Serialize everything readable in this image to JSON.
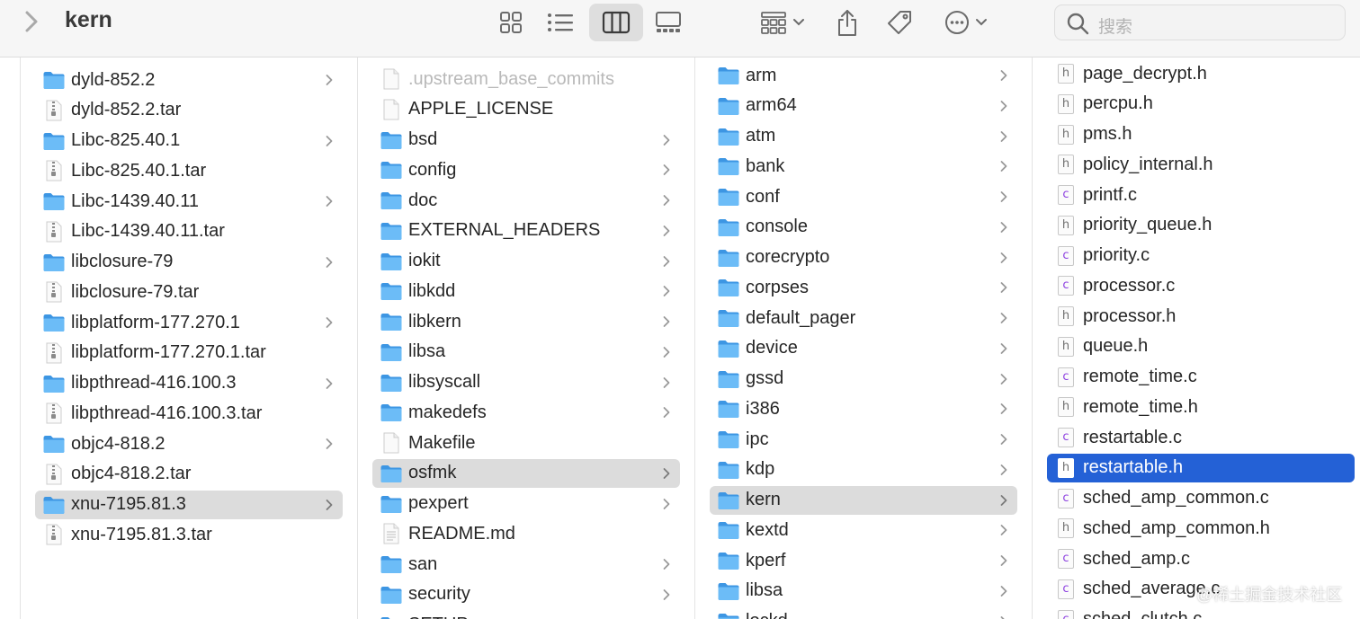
{
  "window": {
    "title": "kern"
  },
  "toolbar": {
    "back_icon": "chevron-left-icon",
    "view_buttons": [
      "icon-view-icon",
      "list-view-icon",
      "column-view-icon",
      "gallery-view-icon"
    ],
    "active_view": "column-view",
    "group_icon": "group-grid-icon",
    "share_icon": "share-icon",
    "tag_icon": "tag-icon",
    "more_icon": "ellipsis-circle-icon",
    "search": {
      "placeholder": "搜索"
    }
  },
  "colors": {
    "selected_row": "#dcdcdc",
    "active_row": "#2461d6",
    "folder": "#5aaef2",
    "c_file_letter": "#8c3fe0"
  },
  "columns": [
    {
      "items": [
        {
          "label": "dyld-852.2",
          "type": "folder",
          "chevron": true
        },
        {
          "label": "dyld-852.2.tar",
          "type": "archive",
          "chevron": false
        },
        {
          "label": "Libc-825.40.1",
          "type": "folder",
          "chevron": true
        },
        {
          "label": "Libc-825.40.1.tar",
          "type": "archive",
          "chevron": false
        },
        {
          "label": "Libc-1439.40.11",
          "type": "folder",
          "chevron": true
        },
        {
          "label": "Libc-1439.40.11.tar",
          "type": "archive",
          "chevron": false
        },
        {
          "label": "libclosure-79",
          "type": "folder",
          "chevron": true
        },
        {
          "label": "libclosure-79.tar",
          "type": "archive",
          "chevron": false
        },
        {
          "label": "libplatform-177.270.1",
          "type": "folder",
          "chevron": true
        },
        {
          "label": "libplatform-177.270.1.tar",
          "type": "archive",
          "chevron": false
        },
        {
          "label": "libpthread-416.100.3",
          "type": "folder",
          "chevron": true
        },
        {
          "label": "libpthread-416.100.3.tar",
          "type": "archive",
          "chevron": false
        },
        {
          "label": "objc4-818.2",
          "type": "folder",
          "chevron": true
        },
        {
          "label": "objc4-818.2.tar",
          "type": "archive",
          "chevron": false
        },
        {
          "label": "xnu-7195.81.3",
          "type": "folder",
          "chevron": true,
          "selected": true
        },
        {
          "label": "xnu-7195.81.3.tar",
          "type": "archive",
          "chevron": false
        }
      ]
    },
    {
      "items": [
        {
          "label": ".upstream_base_commits",
          "type": "file",
          "chevron": false,
          "dim": true
        },
        {
          "label": "APPLE_LICENSE",
          "type": "file",
          "chevron": false
        },
        {
          "label": "bsd",
          "type": "folder",
          "chevron": true
        },
        {
          "label": "config",
          "type": "folder",
          "chevron": true
        },
        {
          "label": "doc",
          "type": "folder",
          "chevron": true
        },
        {
          "label": "EXTERNAL_HEADERS",
          "type": "folder",
          "chevron": true
        },
        {
          "label": "iokit",
          "type": "folder",
          "chevron": true
        },
        {
          "label": "libkdd",
          "type": "folder",
          "chevron": true
        },
        {
          "label": "libkern",
          "type": "folder",
          "chevron": true
        },
        {
          "label": "libsa",
          "type": "folder",
          "chevron": true
        },
        {
          "label": "libsyscall",
          "type": "folder",
          "chevron": true
        },
        {
          "label": "makedefs",
          "type": "folder",
          "chevron": true
        },
        {
          "label": "Makefile",
          "type": "file",
          "chevron": false
        },
        {
          "label": "osfmk",
          "type": "folder",
          "chevron": true,
          "selected": true
        },
        {
          "label": "pexpert",
          "type": "folder",
          "chevron": true
        },
        {
          "label": "README.md",
          "type": "textfile",
          "chevron": false
        },
        {
          "label": "san",
          "type": "folder",
          "chevron": true
        },
        {
          "label": "security",
          "type": "folder",
          "chevron": true
        },
        {
          "label": "SETUP",
          "type": "folder",
          "chevron": true
        }
      ]
    },
    {
      "items": [
        {
          "label": "arm",
          "type": "folder",
          "chevron": true
        },
        {
          "label": "arm64",
          "type": "folder",
          "chevron": true
        },
        {
          "label": "atm",
          "type": "folder",
          "chevron": true
        },
        {
          "label": "bank",
          "type": "folder",
          "chevron": true
        },
        {
          "label": "conf",
          "type": "folder",
          "chevron": true
        },
        {
          "label": "console",
          "type": "folder",
          "chevron": true
        },
        {
          "label": "corecrypto",
          "type": "folder",
          "chevron": true
        },
        {
          "label": "corpses",
          "type": "folder",
          "chevron": true
        },
        {
          "label": "default_pager",
          "type": "folder",
          "chevron": true
        },
        {
          "label": "device",
          "type": "folder",
          "chevron": true
        },
        {
          "label": "gssd",
          "type": "folder",
          "chevron": true
        },
        {
          "label": "i386",
          "type": "folder",
          "chevron": true
        },
        {
          "label": "ipc",
          "type": "folder",
          "chevron": true
        },
        {
          "label": "kdp",
          "type": "folder",
          "chevron": true
        },
        {
          "label": "kern",
          "type": "folder",
          "chevron": true,
          "selected": true
        },
        {
          "label": "kextd",
          "type": "folder",
          "chevron": true
        },
        {
          "label": "kperf",
          "type": "folder",
          "chevron": true
        },
        {
          "label": "libsa",
          "type": "folder",
          "chevron": true
        },
        {
          "label": "lockd",
          "type": "folder",
          "chevron": true
        }
      ]
    },
    {
      "items": [
        {
          "label": "page_decrypt.h",
          "type": "h"
        },
        {
          "label": "percpu.h",
          "type": "h"
        },
        {
          "label": "pms.h",
          "type": "h"
        },
        {
          "label": "policy_internal.h",
          "type": "h"
        },
        {
          "label": "printf.c",
          "type": "c"
        },
        {
          "label": "priority_queue.h",
          "type": "h"
        },
        {
          "label": "priority.c",
          "type": "c"
        },
        {
          "label": "processor.c",
          "type": "c"
        },
        {
          "label": "processor.h",
          "type": "h"
        },
        {
          "label": "queue.h",
          "type": "h"
        },
        {
          "label": "remote_time.c",
          "type": "c"
        },
        {
          "label": "remote_time.h",
          "type": "h"
        },
        {
          "label": "restartable.c",
          "type": "c"
        },
        {
          "label": "restartable.h",
          "type": "h",
          "active": true
        },
        {
          "label": "sched_amp_common.c",
          "type": "c"
        },
        {
          "label": "sched_amp_common.h",
          "type": "h"
        },
        {
          "label": "sched_amp.c",
          "type": "c"
        },
        {
          "label": "sched_average.c",
          "type": "c"
        },
        {
          "label": "sched_clutch.c",
          "type": "c"
        }
      ]
    }
  ],
  "watermark": "@稀土掘金技术社区"
}
